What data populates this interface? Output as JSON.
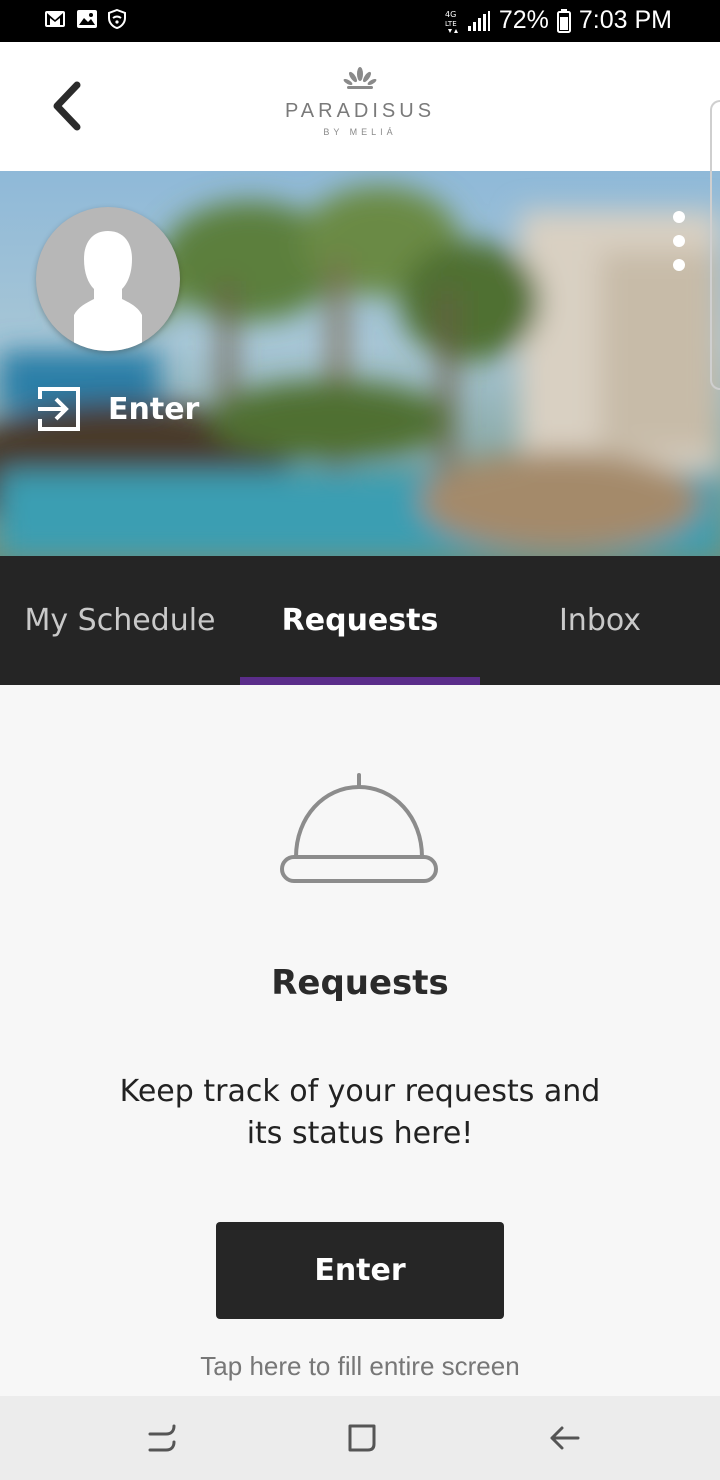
{
  "status_bar": {
    "network": "4G LTE",
    "battery": "72%",
    "time": "7:03 PM"
  },
  "header": {
    "brand": "PARADISUS",
    "brand_sub": "BY MELIÁ"
  },
  "hero": {
    "enter_label": "Enter"
  },
  "tabs": [
    {
      "label": "My Schedule",
      "active": false
    },
    {
      "label": "Requests",
      "active": true
    },
    {
      "label": "Inbox",
      "active": false
    }
  ],
  "content": {
    "title": "Requests",
    "description": "Keep track of your requests and its status here!",
    "button_label": "Enter",
    "hint": "Tap here to fill entire screen"
  },
  "colors": {
    "tab_bar": "#252525",
    "tab_indicator": "#5b2d8a",
    "button": "#262626"
  }
}
